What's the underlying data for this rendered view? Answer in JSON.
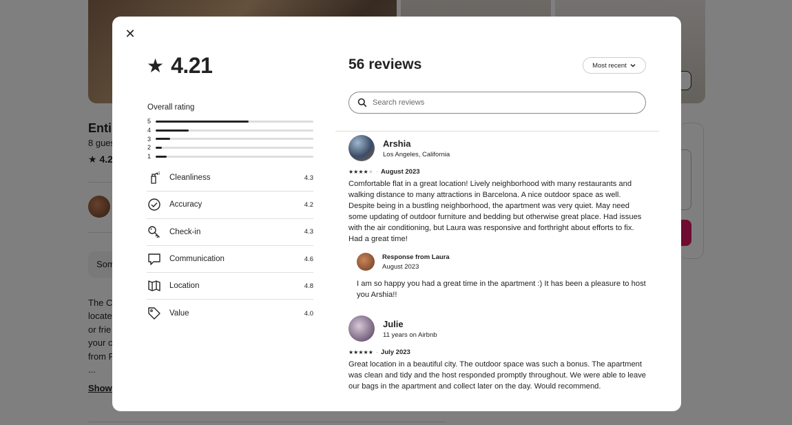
{
  "background": {
    "title": "Enti",
    "subtitle": "8 gues",
    "rating": "★ 4.2",
    "pill": "Som",
    "description_lines": [
      "The C",
      "locate",
      "or frie",
      "your c",
      "from F",
      "..."
    ],
    "show_more": "Show"
  },
  "modal": {
    "close_glyph": "✕",
    "overall_rating": "4.21",
    "overall_label": "Overall rating",
    "rating_bars": [
      {
        "label": "5",
        "fraction": 0.59
      },
      {
        "label": "4",
        "fraction": 0.21
      },
      {
        "label": "3",
        "fraction": 0.09
      },
      {
        "label": "2",
        "fraction": 0.04
      },
      {
        "label": "1",
        "fraction": 0.07
      }
    ],
    "categories": [
      {
        "name": "Cleanliness",
        "value": "4.3",
        "icon": "spray-bottle-icon"
      },
      {
        "name": "Accuracy",
        "value": "4.2",
        "icon": "check-circle-icon"
      },
      {
        "name": "Check-in",
        "value": "4.3",
        "icon": "key-icon"
      },
      {
        "name": "Communication",
        "value": "4.6",
        "icon": "chat-bubble-icon"
      },
      {
        "name": "Location",
        "value": "4.8",
        "icon": "map-icon"
      },
      {
        "name": "Value",
        "value": "4.0",
        "icon": "price-tag-icon"
      }
    ],
    "reviews_title": "56 reviews",
    "sort_label": "Most recent",
    "search_placeholder": "Search reviews",
    "reviews": [
      {
        "name": "Arshia",
        "subtitle": "Los Angeles, California",
        "stars": 4,
        "date": "August 2023",
        "text": "Comfortable flat in a great location! Lively neighborhood with many restaurants and walking distance to many attractions in Barcelona. A nice outdoor space as well. Despite being in a bustling neighborhood, the apartment was very quiet. May need some updating of outdoor furniture and bedding but otherwise great place. Had issues with the air conditioning, but Laura was responsive and forthright about efforts to fix. Had a great time!",
        "response": {
          "from": "Response from Laura",
          "date": "August 2023",
          "text": "I am so happy you had a great time in the apartment :) It has been a pleasure to host you Arshia!!"
        }
      },
      {
        "name": "Julie",
        "subtitle": "11 years on Airbnb",
        "stars": 5,
        "date": "July 2023",
        "text": "Great location in a beautiful city. The outdoor space was such a bonus. The apartment was clean and tidy and the host responded promptly throughout. We were able to leave our bags in the apartment and collect later on the day. Would recommend."
      }
    ]
  }
}
